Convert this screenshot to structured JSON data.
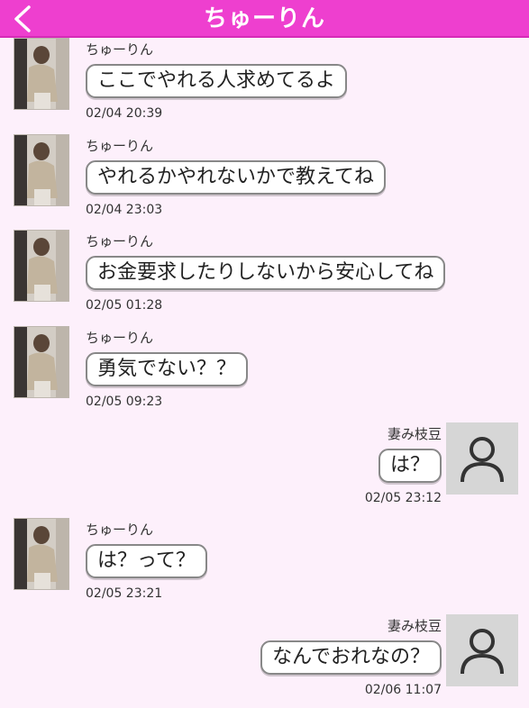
{
  "header": {
    "title": "ちゅーりん"
  },
  "messages": [
    {
      "side": "in",
      "sender": "ちゅーりん",
      "text": "ここでやれる人求めてるよ",
      "time": "02/04 20:39"
    },
    {
      "side": "in",
      "sender": "ちゅーりん",
      "text": "やれるかやれないかで教えてね",
      "time": "02/04 23:03"
    },
    {
      "side": "in",
      "sender": "ちゅーりん",
      "text": "お金要求したりしないから安心してね",
      "time": "02/05 01:28"
    },
    {
      "side": "in",
      "sender": "ちゅーりん",
      "text": "勇気でない？？",
      "time": "02/05 09:23"
    },
    {
      "side": "out",
      "sender": "妻み枝豆",
      "text": "は？",
      "time": "02/05 23:12"
    },
    {
      "side": "in",
      "sender": "ちゅーりん",
      "text": "は？って？",
      "time": "02/05 23:21"
    },
    {
      "side": "out",
      "sender": "妻み枝豆",
      "text": "なんでおれなの？",
      "time": "02/06 11:07"
    }
  ],
  "colors": {
    "header": "#ee3fcf",
    "background": "#fdf0fb",
    "bubble": "#ffffff",
    "bubble_border": "#888888",
    "default_avatar": "#d6d6d6"
  },
  "icons": {
    "back": "chevron-left-icon",
    "default_avatar": "user-silhouette-icon"
  }
}
